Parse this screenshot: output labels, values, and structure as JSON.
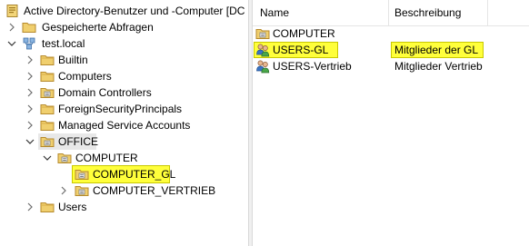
{
  "tree": {
    "root_label": "Active Directory-Benutzer und -Computer [DC",
    "saved_queries": "Gespeicherte Abfragen",
    "domain": "test.local",
    "items": [
      {
        "label": "Builtin"
      },
      {
        "label": "Computers"
      },
      {
        "label": "Domain Controllers"
      },
      {
        "label": "ForeignSecurityPrincipals"
      },
      {
        "label": "Managed Service Accounts"
      },
      {
        "label": "OFFICE"
      }
    ],
    "office_children": {
      "computer": "COMPUTER",
      "computer_gl": "COMPUTER_GL",
      "computer_vertrieb": "COMPUTER_VERTRIEB"
    },
    "users": "Users"
  },
  "list": {
    "columns": {
      "name": "Name",
      "description": "Beschreibung"
    },
    "rows": [
      {
        "name": "COMPUTER",
        "description": "",
        "icon": "ou-folder-icon"
      },
      {
        "name": "USERS-GL",
        "description": "Mitglieder der GL",
        "icon": "group-icon"
      },
      {
        "name": "USERS-Vertrieb",
        "description": "Mitglieder Vertrieb",
        "icon": "group-icon"
      }
    ]
  },
  "colors": {
    "highlight": "#ffff3b",
    "highlight_border": "#c8c800",
    "folder": "#dcb45a",
    "selection": "#e5f3ff"
  }
}
